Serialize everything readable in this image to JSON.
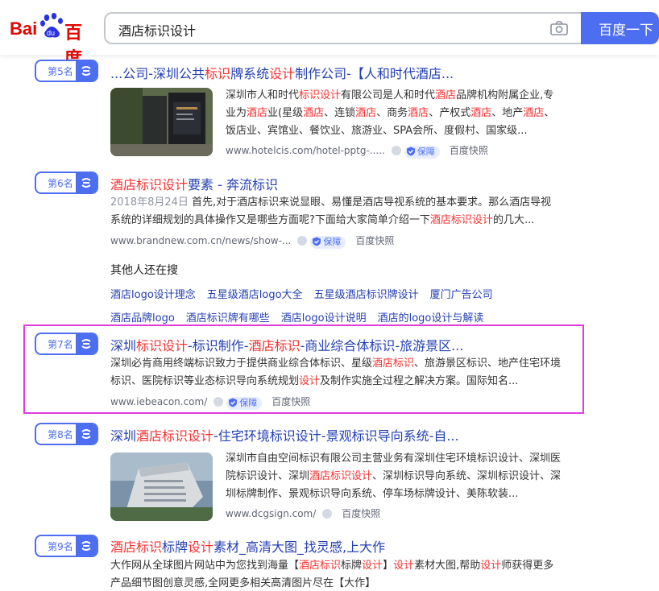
{
  "header": {
    "logo_text_1": "Bai",
    "logo_text_2": "du",
    "logo_text_3": "百度",
    "search_value": "酒店标识设计",
    "search_button": "百度一下",
    "colors": {
      "accent": "#4e6ef2",
      "logo_red": "#e10601",
      "logo_blue": "#2932e1"
    }
  },
  "results": [
    {
      "rank": "第5名",
      "title_parts": [
        {
          "t": "...公司-深圳公共",
          "hl": false
        },
        {
          "t": "标识",
          "hl": true
        },
        {
          "t": "牌系统",
          "hl": false
        },
        {
          "t": "设计",
          "hl": true
        },
        {
          "t": "制作公司-【人和时代酒店...",
          "hl": false
        }
      ],
      "abstract_lines": [
        [
          {
            "t": "深圳市人和时代",
            "hl": false
          },
          {
            "t": "标识设计",
            "hl": true
          },
          {
            "t": "有限公司是人和时代",
            "hl": false
          },
          {
            "t": "酒店",
            "hl": true
          },
          {
            "t": "品牌机构附属企业,专",
            "hl": false
          }
        ],
        [
          {
            "t": "业为",
            "hl": false
          },
          {
            "t": "酒店",
            "hl": true
          },
          {
            "t": "业(星级",
            "hl": false
          },
          {
            "t": "酒店",
            "hl": true
          },
          {
            "t": "、连锁",
            "hl": false
          },
          {
            "t": "酒店",
            "hl": true
          },
          {
            "t": "、商务",
            "hl": false
          },
          {
            "t": "酒店",
            "hl": true
          },
          {
            "t": "、产权式",
            "hl": false
          },
          {
            "t": "酒店",
            "hl": true
          },
          {
            "t": "、地产",
            "hl": false
          },
          {
            "t": "酒店",
            "hl": true
          },
          {
            "t": "、",
            "hl": false
          }
        ],
        [
          {
            "t": "饭店业、宾馆业、餐饮业、旅游业、SPA会所、度假村、国家级...",
            "hl": false
          }
        ]
      ],
      "url": "www.hotelcis.com/hotel-pptg-.....",
      "badge": "保障",
      "snapshot": "百度快照"
    },
    {
      "rank": "第6名",
      "title_parts": [
        {
          "t": "酒店标识设计",
          "hl": true
        },
        {
          "t": "要素 - 奔流标识",
          "hl": false
        }
      ],
      "date": "2018年8月24日",
      "abstract_lines": [
        [
          {
            "t": " 首先,对于酒店标识来说显眼、易懂是酒店导视系统的基本要求。那么酒店导视系",
            "hl": false
          }
        ],
        [
          {
            "t": "统的详细规划的具体操作又是哪些方面呢?下面给大家简单介绍一下",
            "hl": false
          },
          {
            "t": "酒店标识设计",
            "hl": true
          },
          {
            "t": "的几大...",
            "hl": false
          }
        ]
      ],
      "url": "www.brandnew.com.cn/news/show-...",
      "badge": "保障",
      "snapshot": "百度快照"
    },
    {
      "rank": "第7名",
      "title_parts": [
        {
          "t": "深圳",
          "hl": false
        },
        {
          "t": "标识设计",
          "hl": true
        },
        {
          "t": "-标识制作-",
          "hl": false
        },
        {
          "t": "酒店标识",
          "hl": true
        },
        {
          "t": "-商业综合体标识-旅游景区...",
          "hl": false
        }
      ],
      "abstract_lines": [
        [
          {
            "t": "深圳必肯商用终端标识致力于提供商业综合体标识、星级",
            "hl": false
          },
          {
            "t": "酒店标识",
            "hl": true
          },
          {
            "t": "、旅游景区标识、地产住宅环境",
            "hl": false
          }
        ],
        [
          {
            "t": "标识、医院标识等业态标识导向系统规划",
            "hl": false
          },
          {
            "t": "设计",
            "hl": true
          },
          {
            "t": "及制作实施全过程之解决方案。国际知名...",
            "hl": false
          }
        ]
      ],
      "url": "www.iebeacon.com/",
      "badge": "保障",
      "snapshot": "百度快照"
    },
    {
      "rank": "第8名",
      "title_parts": [
        {
          "t": "深圳",
          "hl": false
        },
        {
          "t": "酒店标识设计",
          "hl": true
        },
        {
          "t": "-住宅环境标识设计-景观标识导向系统-自...",
          "hl": false
        }
      ],
      "abstract_lines": [
        [
          {
            "t": "深圳市自由空间标识有限公司主营业务有深圳住宅环境标识设计、深圳医",
            "hl": false
          }
        ],
        [
          {
            "t": "院标识设计、深圳",
            "hl": false
          },
          {
            "t": "酒店标识设计",
            "hl": true
          },
          {
            "t": "、深圳标识导向系统、深圳标识设计、深",
            "hl": false
          }
        ],
        [
          {
            "t": "圳标牌制作、景观标识导向系统、停车场标牌设计、美陈软装...",
            "hl": false
          }
        ]
      ],
      "url": "www.dcgsign.com/",
      "snapshot": "百度快照"
    },
    {
      "rank": "第9名",
      "title_parts": [
        {
          "t": "酒店标识",
          "hl": true
        },
        {
          "t": "标牌",
          "hl": false
        },
        {
          "t": "设计",
          "hl": true
        },
        {
          "t": "素材_高清大图_找灵感,上大作",
          "hl": false
        }
      ],
      "abstract_lines": [
        [
          {
            "t": "大作网从全球图片网站中为您找到海量【",
            "hl": false
          },
          {
            "t": "酒店标识",
            "hl": true
          },
          {
            "t": "标牌",
            "hl": false
          },
          {
            "t": "设计",
            "hl": true
          },
          {
            "t": "】",
            "hl": false
          },
          {
            "t": "设计",
            "hl": true
          },
          {
            "t": "素材大图,帮助",
            "hl": false
          },
          {
            "t": "设计",
            "hl": true
          },
          {
            "t": "师获得更多",
            "hl": false
          }
        ],
        [
          {
            "t": "产品细节图创意灵感,全网更多相关高清图片尽在【大作】",
            "hl": false
          }
        ]
      ]
    }
  ],
  "others": {
    "heading": "其他人还在搜",
    "row1": [
      "酒店logo设计理念",
      "五星级酒店logo大全",
      "五星级酒店标识牌设计",
      "厦门广告公司"
    ],
    "row2": [
      "酒店品牌logo",
      "酒店标识牌有哪些",
      "酒店logo设计说明",
      "酒店的logo设计与解读"
    ]
  }
}
